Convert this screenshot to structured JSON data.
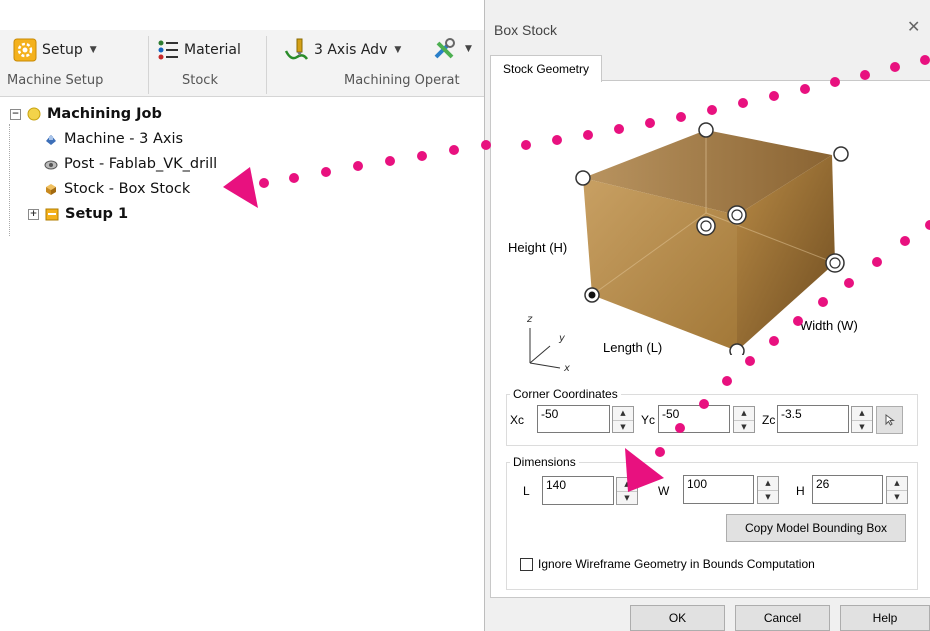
{
  "ribbon": {
    "setup_label": "Setup",
    "material_label": "Material",
    "three_axis_label": "3 Axis Adv",
    "group_machine_setup": "Machine Setup",
    "group_stock": "Stock",
    "group_machining_operations": "Machining Operat"
  },
  "tree": {
    "root": "Machining Job",
    "items": [
      "Machine - 3 Axis",
      "Post - Fablab_VK_drill",
      "Stock - Box Stock"
    ],
    "setup": "Setup 1"
  },
  "dialog": {
    "title": "Box Stock",
    "close": "✕",
    "tab": "Stock Geometry",
    "labels": {
      "height": "Height (H)",
      "length": "Length (L)",
      "width": "Width (W)",
      "axis_z": "z",
      "axis_y": "y",
      "axis_x": "x"
    },
    "corner": {
      "title": "Corner Coordinates",
      "xc_label": "Xc",
      "xc": "-50",
      "yc_label": "Yc",
      "yc": "-50",
      "zc_label": "Zc",
      "zc": "-3.5"
    },
    "dimensions": {
      "title": "Dimensions",
      "l_label": "L",
      "l": "140",
      "w_label": "W",
      "w": "100",
      "h_label": "H",
      "h": "26"
    },
    "copy_bbox": "Copy Model Bounding Box",
    "ignore_wireframe": "Ignore Wireframe Geometry in Bounds Computation",
    "ok": "OK",
    "cancel": "Cancel",
    "help": "Help"
  },
  "colors": {
    "annotation": "#e8117f",
    "ribbon_bg": "#f3f3f3",
    "dialog_bg": "#f0f0f0",
    "cube_light": "#d8b57e",
    "cube_dark": "#8a6433"
  }
}
